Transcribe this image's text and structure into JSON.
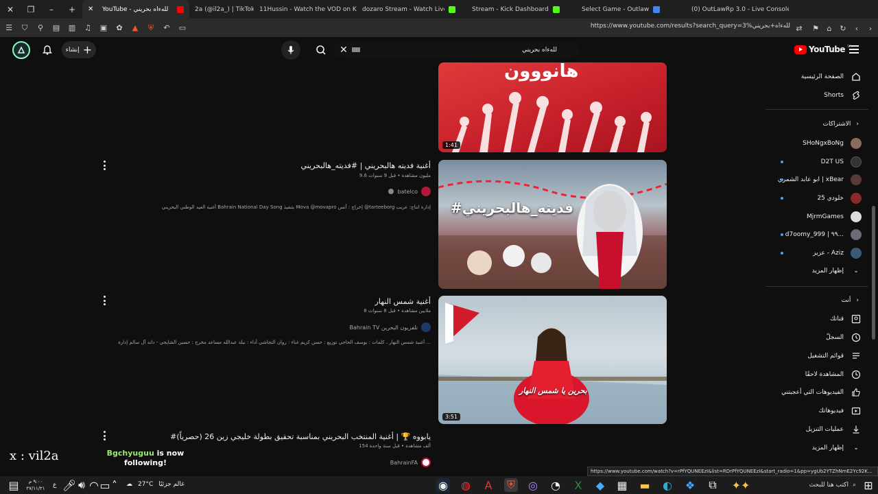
{
  "browser": {
    "tabs": [
      {
        "title": "",
        "active": false
      },
      {
        "title": "YouTube - للهءاه بحريني",
        "active": true,
        "favicon_color": "#ff0000"
      },
      {
        "title": "2a (@il2a_) | TikTok",
        "active": false,
        "favicon_color": "#ffffff"
      },
      {
        "title": "11Hussin - Watch the VOD on Kick",
        "active": false,
        "favicon_color": "#53fc18"
      },
      {
        "title": "dozaro Stream - Watch Live on K",
        "active": false,
        "favicon_color": "#53fc18"
      },
      {
        "title": "Stream - Kick Dashboard",
        "active": false,
        "favicon_color": "#53fc18"
      },
      {
        "title": "Select Game - Outlaw",
        "active": false,
        "favicon_color": "#53fc18"
      },
      {
        "title": "(0) OutLawRp 3.0 - Live Console",
        "active": false,
        "favicon_color": "#4285f4"
      }
    ],
    "new_tab_icon": "plus-icon",
    "url": "https://www.youtube.com/results?search_query=3%للهءاه+بحريني"
  },
  "youtube": {
    "logo_text": "YouTube",
    "logo_region": "SA",
    "search_value": "للهءاه بحريني",
    "create_label": "إنشاء",
    "sidebar": {
      "top_items": [
        {
          "label": "الصفحة الرئيسية",
          "icon": "home-icon"
        },
        {
          "label": "Shorts",
          "icon": "shorts-icon"
        }
      ],
      "subscriptions_header": "الاشتراكات",
      "subscriptions": [
        {
          "label": "SHoNgxBoNg",
          "dot": false,
          "color": "#8a6a5a"
        },
        {
          "label": "D2T US",
          "dot": true,
          "color": "#333333"
        },
        {
          "label": "ابو عابد الشمري | xBear",
          "dot": true,
          "color": "#5a3a3a"
        },
        {
          "label": "خلودي 25",
          "dot": true,
          "color": "#8a2a2a"
        },
        {
          "label": "MjrmGames",
          "dot": false,
          "color": "#dddddd"
        },
        {
          "label": "d7oomy_999 | ٩٩...",
          "dot": true,
          "color": "#6a6a7a"
        },
        {
          "label": "عزيز - Aziz",
          "dot": true,
          "color": "#3a5a7a"
        }
      ],
      "show_more_1": "إظهار المزيد",
      "you_header": "أنت",
      "you_items": [
        {
          "label": "قناتك",
          "icon": "channel-icon"
        },
        {
          "label": "السجلّ",
          "icon": "history-icon"
        },
        {
          "label": "قوائم التشغيل",
          "icon": "playlists-icon"
        },
        {
          "label": "المشاهدة لاحقًا",
          "icon": "watch-later-icon"
        },
        {
          "label": "الفيديوهات التي أعجبتني",
          "icon": "like-icon"
        },
        {
          "label": "فيديوهاتك",
          "icon": "your-videos-icon"
        },
        {
          "label": "عمليات التنزيل",
          "icon": "download-icon"
        },
        {
          "label": "إظهار المزيد",
          "icon": "chevron-down-icon"
        }
      ]
    },
    "results": [
      {
        "duration": "1:41",
        "thumb_text": "هانووون"
      },
      {
        "title": "أغنية فديته هالبحريني | #فديته_هالبحريني",
        "meta": "9.6 مليون مشاهدة • قبل 9 سنوات",
        "channel": "batelco",
        "verified": true,
        "desc": "أغنية العيد الوطني البحريني Bahrain National Day Song بتنفيذ Mova @movapro إخراج : أنس @tarteeborg إدارة انتاج: عريب",
        "thumb_text": "#فديته_هالبحريني"
      },
      {
        "title": "أغنية شمس النهار",
        "meta": "8 ملايين مشاهدة • قبل 8 سنوات",
        "channel": "Bahrain TV تلفزيون البحرين",
        "verified": false,
        "desc": "أغنية شمس النهار ، كلمات : يوسف الحاجي توزيع : حسن كريم غناء : روان النجاشي أداء : نيلة عبدالله مساعد مخرج : حسين الشايجي - دانه آل سالم إدارة ...",
        "duration": "3:51",
        "thumb_text": "بحرين يا شمس النهار"
      },
      {
        "title": "#يابووه 🏆 | أغنية المنتخب البحريني بمناسبة تحقيق بطولة خليجي زين 26 (حصرياً)",
        "meta": "154 ألف مشاهدة • قبل سنة واحدة",
        "channel": "BahrainFA",
        "verified": false
      }
    ]
  },
  "overlay": {
    "watermark": "x : vil2a",
    "follow_name": "Bgchyuguu",
    "follow_text1": "is now",
    "follow_text2": "following!",
    "hover_url": "https://www.youtube.com/watch?v=rPfYQUNEEzI&list=RDrPfYQUNEEzI&start_radio=1&pp=ygUb2YTZhNmE2Yc92K..."
  },
  "taskbar": {
    "search_placeholder": "اكتب هنا للبحث",
    "weather": "27°C",
    "weather_label": "غالم جزئيًا",
    "time": "٩:٠٠ م",
    "date": "٢٧/١١/٢١",
    "lang": "ع"
  }
}
